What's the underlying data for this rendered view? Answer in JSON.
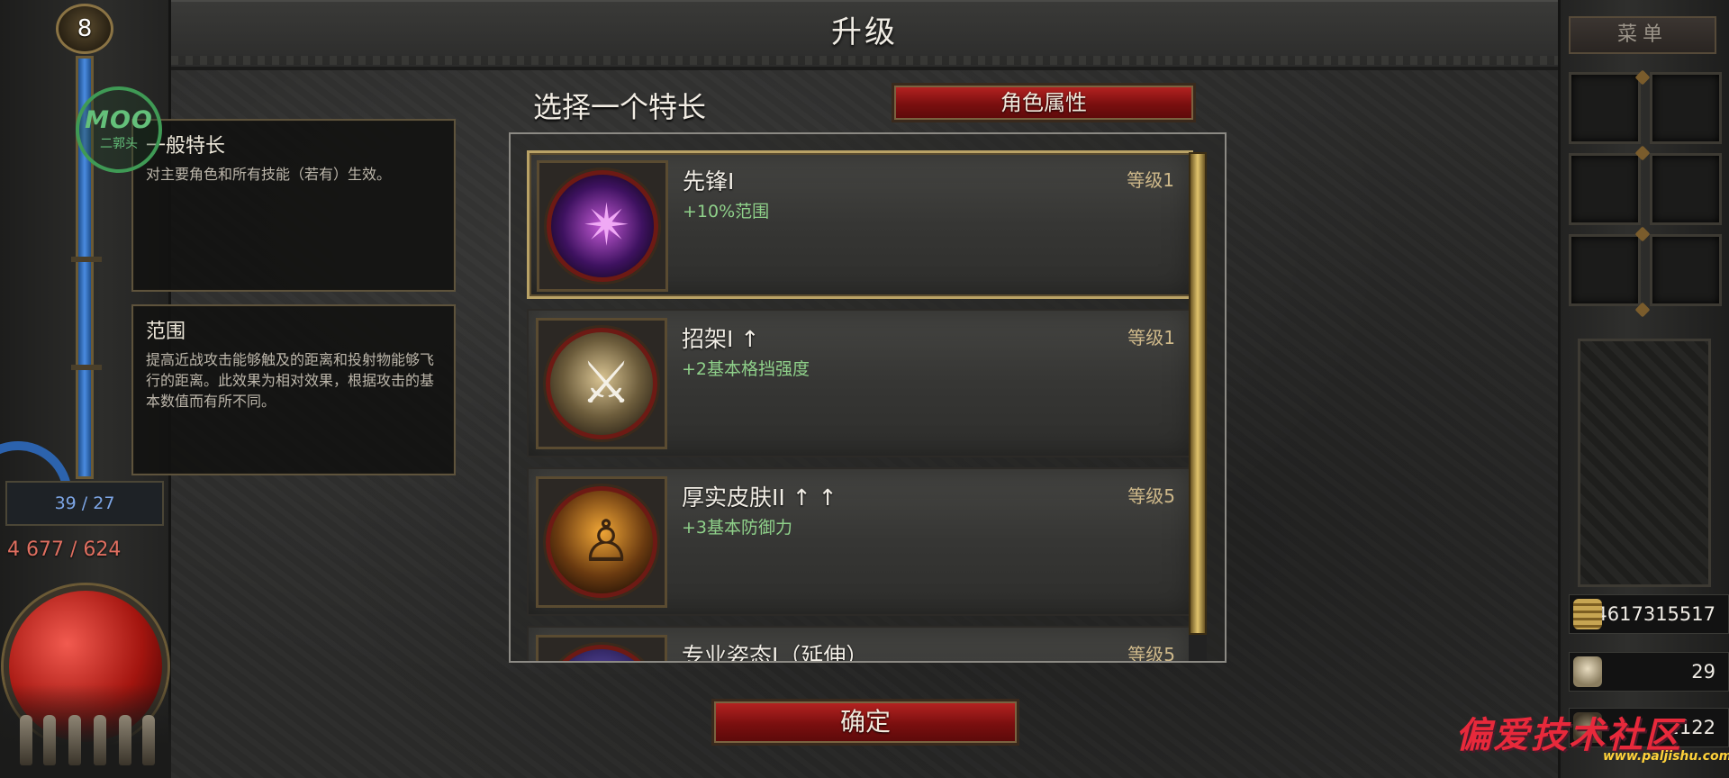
{
  "header": {
    "title": "升级"
  },
  "hud_left": {
    "level": "8",
    "mana": "39 / 27",
    "life": "4 677 / 624"
  },
  "watermark_logo": {
    "big": "MOO",
    "small": "二郭头"
  },
  "tooltips": [
    {
      "title": "一般特长",
      "desc": "对主要角色和所有技能（若有）生效。"
    },
    {
      "title": "范围",
      "desc": "提高近战攻击能够触及的距离和投射物能够飞行的距离。此效果为相对效果，根据攻击的基本数值而有所不同。"
    }
  ],
  "main": {
    "choose_label": "选择一个特长",
    "attributes_button": "角色属性",
    "confirm_button": "确定"
  },
  "perks": [
    {
      "name": "先锋I",
      "bonus": "+10%范围",
      "level": "等级1",
      "icon": "purple-blade-burst-icon",
      "selected": true
    },
    {
      "name": "招架I ↑",
      "bonus": "+2基本格挡强度",
      "level": "等级1",
      "icon": "crossed-swords-icon",
      "selected": false
    },
    {
      "name": "厚实皮肤II ↑ ↑",
      "bonus": "+3基本防御力",
      "level": "等级5",
      "icon": "glowing-body-icon",
      "selected": false
    },
    {
      "name": "专业姿态I（延伸）",
      "bonus": "",
      "level": "等级5",
      "icon": "partial-perk-icon",
      "selected": false
    }
  ],
  "hud_right": {
    "menu_button": "菜单",
    "gold": "4617315517",
    "skulls": "29",
    "third": "2122"
  },
  "site_watermark": {
    "text": "偏爱技术社区",
    "url": "www.paljishu.com"
  },
  "colors": {
    "accent_red": "#9e1a17",
    "bonus_green": "#8fd18a",
    "gold_trim": "#b9a266",
    "mana_blue": "#4a8be0",
    "life_red": "#e06f60"
  }
}
